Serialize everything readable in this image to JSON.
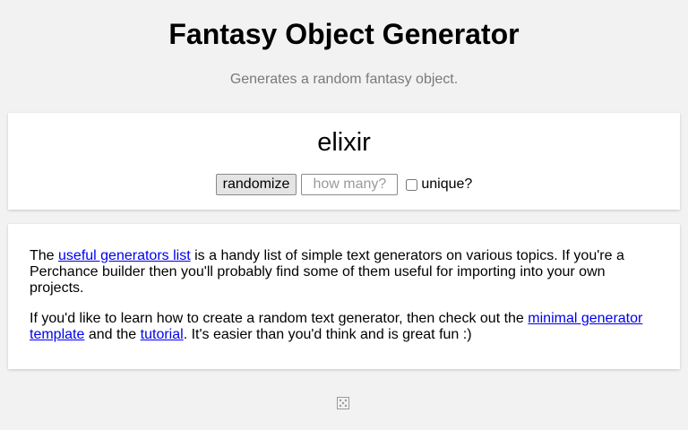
{
  "header": {
    "title": "Fantasy Object Generator",
    "subtitle": "Generates a random fantasy object."
  },
  "generator": {
    "output": "elixir",
    "randomize_label": "randomize",
    "count_placeholder": "how many?",
    "count_value": "",
    "unique_label": "unique?",
    "unique_checked": false
  },
  "info": {
    "p1_pre": "The ",
    "p1_link": "useful generators list",
    "p1_post": " is a handy list of simple text generators on various topics. If you're a Perchance builder then you'll probably find some of them useful for importing into your own projects.",
    "p2_pre": "If you'd like to learn how to create a random text generator, then check out the ",
    "p2_link1": "minimal generator template",
    "p2_mid": " and the ",
    "p2_link2": "tutorial",
    "p2_post": ". It's easier than you'd think and is great fun :)"
  },
  "footer": {
    "icon": "dice-icon"
  },
  "colors": {
    "background": "#f2f2f2",
    "card": "#ffffff",
    "link": "#0000ee",
    "subtitle": "#7a7a7a"
  }
}
